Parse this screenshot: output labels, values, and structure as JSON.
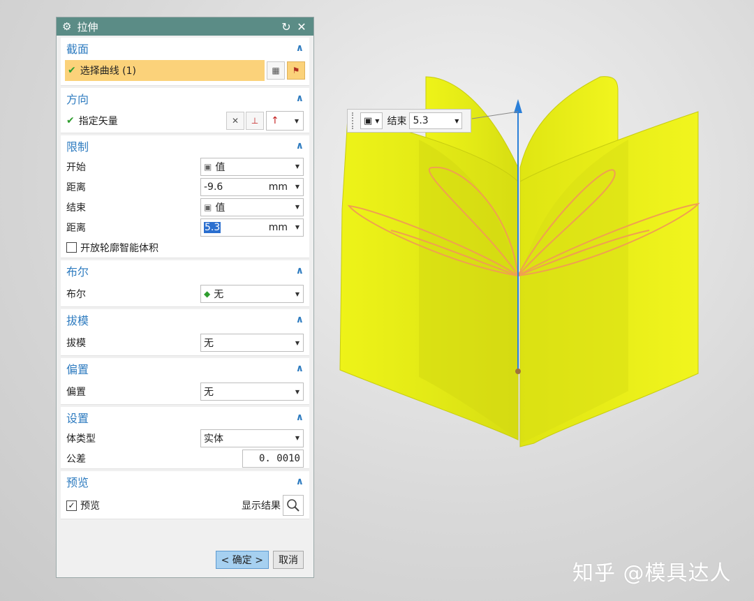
{
  "dialog": {
    "title": "拉伸",
    "sections": {
      "section": {
        "header": "截面",
        "select_curve": "选择曲线 (1)"
      },
      "direction": {
        "header": "方向",
        "specify_vector": "指定矢量"
      },
      "limits": {
        "header": "限制",
        "start_label": "开始",
        "start_value": "值",
        "start_distance_label": "距离",
        "start_distance_value": "-9.6",
        "start_unit": "mm",
        "end_label": "结束",
        "end_value": "值",
        "end_distance_label": "距离",
        "end_distance_value": "5.3",
        "end_unit": "mm",
        "open_profile_label": "开放轮廓智能体积"
      },
      "boolean": {
        "header": "布尔",
        "label": "布尔",
        "value": "无"
      },
      "draft": {
        "header": "拔模",
        "label": "拔模",
        "value": "无"
      },
      "offset": {
        "header": "偏置",
        "label": "偏置",
        "value": "无"
      },
      "settings": {
        "header": "设置",
        "body_type_label": "体类型",
        "body_type_value": "实体",
        "tolerance_label": "公差",
        "tolerance_value": "0. 0010"
      },
      "preview": {
        "header": "预览",
        "preview_label": "预览",
        "show_result_label": "显示结果"
      }
    },
    "buttons": {
      "ok": "< 确定 >",
      "cancel": "取消"
    }
  },
  "float_toolbar": {
    "end_label": "结束",
    "end_value": "5.3"
  },
  "watermark": "知乎 @模具达人",
  "colors": {
    "title_bar": "#5b8c86",
    "section_header": "#2f7cc0",
    "selection_highlight": "#fbd27a",
    "surface_yellow": "#e8ee1c",
    "curve_orange": "#f0a050",
    "vector_blue": "#2a7fd8"
  }
}
